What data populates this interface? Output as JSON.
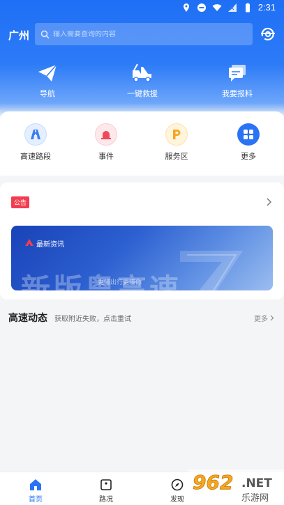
{
  "status_bar": {
    "time": "2:31"
  },
  "header": {
    "city": "广州",
    "search_placeholder": "输入需要查询的内容",
    "quick_actions": [
      {
        "label": "导航",
        "icon": "paper-plane-icon"
      },
      {
        "label": "一键救援",
        "icon": "tow-truck-icon"
      },
      {
        "label": "我要报料",
        "icon": "chat-report-icon"
      }
    ]
  },
  "categories": [
    {
      "label": "高速路段",
      "icon": "highway-road-icon",
      "color": "#3a7bf6"
    },
    {
      "label": "事件",
      "icon": "alarm-light-icon",
      "color": "#f04a5a"
    },
    {
      "label": "服务区",
      "icon": "parking-p-icon",
      "color": "#f5a623"
    },
    {
      "label": "更多",
      "icon": "grid-more-icon",
      "color": "#2a73f5"
    }
  ],
  "notice": {
    "badge": "公告",
    "banner": {
      "title": "最新资讯",
      "slogan": "更懂出行更懂你",
      "big_text": "新版粤高速"
    }
  },
  "highway_dynamics": {
    "title": "高速动态",
    "message": "获取附近失败，点击重试",
    "more": "更多"
  },
  "tabs": [
    {
      "label": "首页",
      "icon": "home-icon",
      "active": true
    },
    {
      "label": "路况",
      "icon": "road-condition-icon",
      "active": false
    },
    {
      "label": "发现",
      "icon": "compass-icon",
      "active": false
    }
  ],
  "watermark": {
    "text": "962",
    "suffix": ".NET",
    "sub": "乐游网"
  },
  "colors": {
    "brand_blue": "#1f6ff6",
    "active_tab": "#2a73f5",
    "badge_red": "#f23d4f"
  }
}
